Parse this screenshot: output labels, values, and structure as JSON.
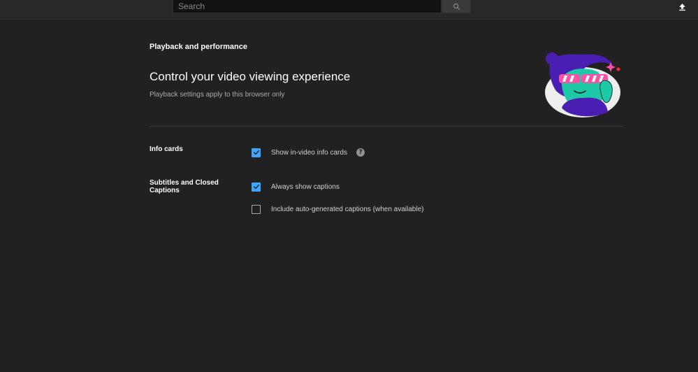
{
  "header": {
    "search_placeholder": "Search",
    "search_icon": "search-icon",
    "upload_icon": "upload-icon"
  },
  "page": {
    "section_title": "Playback and performance",
    "headline": "Control your video viewing experience",
    "subhead": "Playback settings apply to this browser only",
    "illustration": "person-with-sunglasses-illustration"
  },
  "settings": [
    {
      "label": "Info cards",
      "options": [
        {
          "label": "Show in-video info cards",
          "checked": true,
          "help": "?"
        }
      ]
    },
    {
      "label": "Subtitles and Closed Captions",
      "options": [
        {
          "label": "Always show captions",
          "checked": true
        },
        {
          "label": "Include auto-generated captions (when available)",
          "checked": false
        }
      ]
    }
  ],
  "colors": {
    "background": "#212121",
    "topbar": "#282828",
    "accent": "#3ea6ff"
  }
}
